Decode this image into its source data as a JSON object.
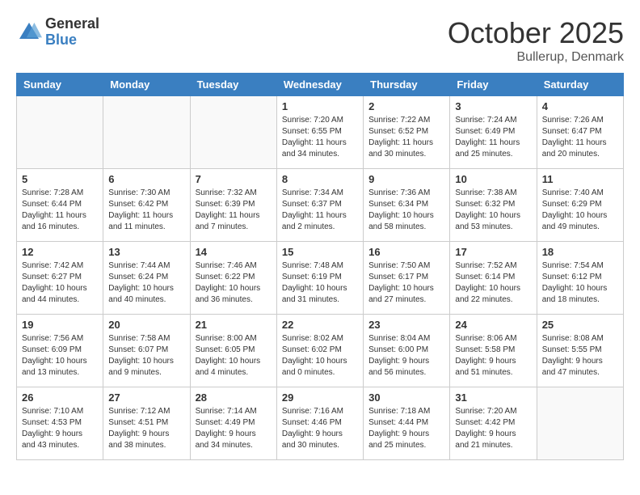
{
  "header": {
    "logo_general": "General",
    "logo_blue": "Blue",
    "month": "October 2025",
    "location": "Bullerup, Denmark"
  },
  "weekdays": [
    "Sunday",
    "Monday",
    "Tuesday",
    "Wednesday",
    "Thursday",
    "Friday",
    "Saturday"
  ],
  "weeks": [
    [
      {
        "day": "",
        "info": ""
      },
      {
        "day": "",
        "info": ""
      },
      {
        "day": "",
        "info": ""
      },
      {
        "day": "1",
        "info": "Sunrise: 7:20 AM\nSunset: 6:55 PM\nDaylight: 11 hours\nand 34 minutes."
      },
      {
        "day": "2",
        "info": "Sunrise: 7:22 AM\nSunset: 6:52 PM\nDaylight: 11 hours\nand 30 minutes."
      },
      {
        "day": "3",
        "info": "Sunrise: 7:24 AM\nSunset: 6:49 PM\nDaylight: 11 hours\nand 25 minutes."
      },
      {
        "day": "4",
        "info": "Sunrise: 7:26 AM\nSunset: 6:47 PM\nDaylight: 11 hours\nand 20 minutes."
      }
    ],
    [
      {
        "day": "5",
        "info": "Sunrise: 7:28 AM\nSunset: 6:44 PM\nDaylight: 11 hours\nand 16 minutes."
      },
      {
        "day": "6",
        "info": "Sunrise: 7:30 AM\nSunset: 6:42 PM\nDaylight: 11 hours\nand 11 minutes."
      },
      {
        "day": "7",
        "info": "Sunrise: 7:32 AM\nSunset: 6:39 PM\nDaylight: 11 hours\nand 7 minutes."
      },
      {
        "day": "8",
        "info": "Sunrise: 7:34 AM\nSunset: 6:37 PM\nDaylight: 11 hours\nand 2 minutes."
      },
      {
        "day": "9",
        "info": "Sunrise: 7:36 AM\nSunset: 6:34 PM\nDaylight: 10 hours\nand 58 minutes."
      },
      {
        "day": "10",
        "info": "Sunrise: 7:38 AM\nSunset: 6:32 PM\nDaylight: 10 hours\nand 53 minutes."
      },
      {
        "day": "11",
        "info": "Sunrise: 7:40 AM\nSunset: 6:29 PM\nDaylight: 10 hours\nand 49 minutes."
      }
    ],
    [
      {
        "day": "12",
        "info": "Sunrise: 7:42 AM\nSunset: 6:27 PM\nDaylight: 10 hours\nand 44 minutes."
      },
      {
        "day": "13",
        "info": "Sunrise: 7:44 AM\nSunset: 6:24 PM\nDaylight: 10 hours\nand 40 minutes."
      },
      {
        "day": "14",
        "info": "Sunrise: 7:46 AM\nSunset: 6:22 PM\nDaylight: 10 hours\nand 36 minutes."
      },
      {
        "day": "15",
        "info": "Sunrise: 7:48 AM\nSunset: 6:19 PM\nDaylight: 10 hours\nand 31 minutes."
      },
      {
        "day": "16",
        "info": "Sunrise: 7:50 AM\nSunset: 6:17 PM\nDaylight: 10 hours\nand 27 minutes."
      },
      {
        "day": "17",
        "info": "Sunrise: 7:52 AM\nSunset: 6:14 PM\nDaylight: 10 hours\nand 22 minutes."
      },
      {
        "day": "18",
        "info": "Sunrise: 7:54 AM\nSunset: 6:12 PM\nDaylight: 10 hours\nand 18 minutes."
      }
    ],
    [
      {
        "day": "19",
        "info": "Sunrise: 7:56 AM\nSunset: 6:09 PM\nDaylight: 10 hours\nand 13 minutes."
      },
      {
        "day": "20",
        "info": "Sunrise: 7:58 AM\nSunset: 6:07 PM\nDaylight: 10 hours\nand 9 minutes."
      },
      {
        "day": "21",
        "info": "Sunrise: 8:00 AM\nSunset: 6:05 PM\nDaylight: 10 hours\nand 4 minutes."
      },
      {
        "day": "22",
        "info": "Sunrise: 8:02 AM\nSunset: 6:02 PM\nDaylight: 10 hours\nand 0 minutes."
      },
      {
        "day": "23",
        "info": "Sunrise: 8:04 AM\nSunset: 6:00 PM\nDaylight: 9 hours\nand 56 minutes."
      },
      {
        "day": "24",
        "info": "Sunrise: 8:06 AM\nSunset: 5:58 PM\nDaylight: 9 hours\nand 51 minutes."
      },
      {
        "day": "25",
        "info": "Sunrise: 8:08 AM\nSunset: 5:55 PM\nDaylight: 9 hours\nand 47 minutes."
      }
    ],
    [
      {
        "day": "26",
        "info": "Sunrise: 7:10 AM\nSunset: 4:53 PM\nDaylight: 9 hours\nand 43 minutes."
      },
      {
        "day": "27",
        "info": "Sunrise: 7:12 AM\nSunset: 4:51 PM\nDaylight: 9 hours\nand 38 minutes."
      },
      {
        "day": "28",
        "info": "Sunrise: 7:14 AM\nSunset: 4:49 PM\nDaylight: 9 hours\nand 34 minutes."
      },
      {
        "day": "29",
        "info": "Sunrise: 7:16 AM\nSunset: 4:46 PM\nDaylight: 9 hours\nand 30 minutes."
      },
      {
        "day": "30",
        "info": "Sunrise: 7:18 AM\nSunset: 4:44 PM\nDaylight: 9 hours\nand 25 minutes."
      },
      {
        "day": "31",
        "info": "Sunrise: 7:20 AM\nSunset: 4:42 PM\nDaylight: 9 hours\nand 21 minutes."
      },
      {
        "day": "",
        "info": ""
      }
    ]
  ]
}
